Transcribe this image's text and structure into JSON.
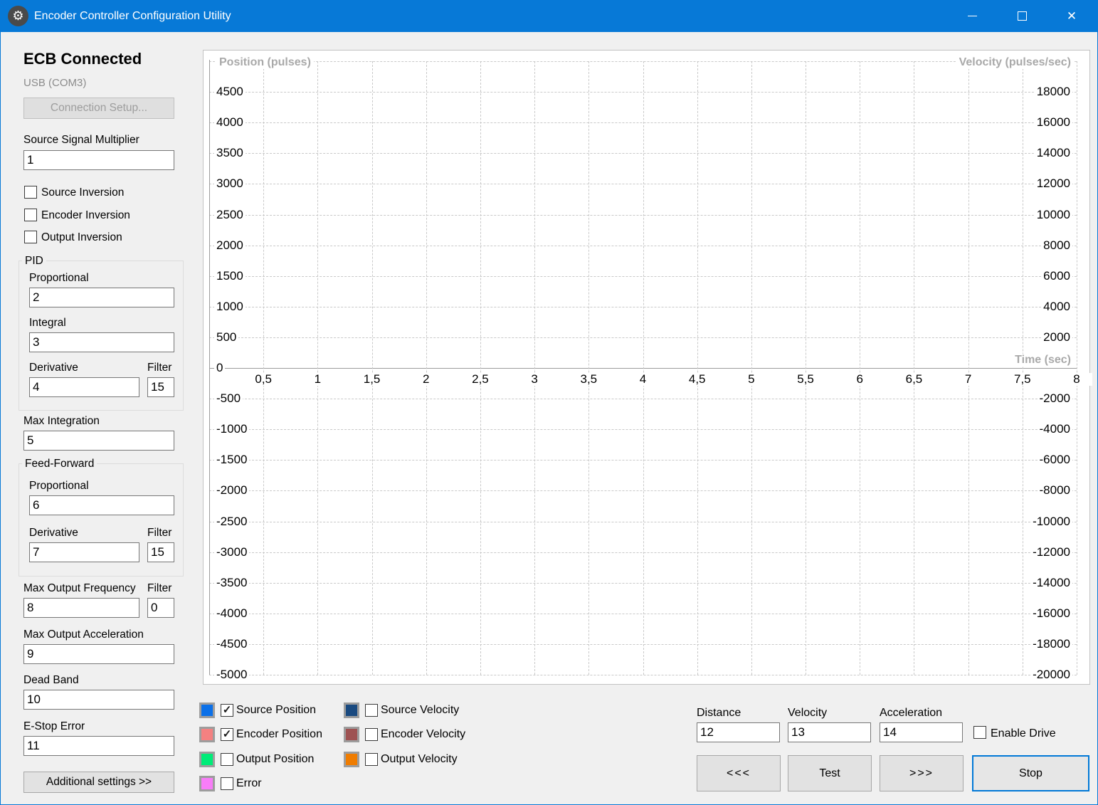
{
  "window": {
    "title": "Encoder Controller Configuration Utility",
    "app_icon_glyph": "⚙",
    "close_glyph": "✕"
  },
  "sidebar": {
    "status_heading": "ECB Connected",
    "port_label": "USB (COM3)",
    "connection_setup_button": "Connection Setup...",
    "source_signal_multiplier": {
      "label": "Source Signal Multiplier",
      "value": "1"
    },
    "source_inversion_label": "Source Inversion",
    "encoder_inversion_label": "Encoder Inversion",
    "output_inversion_label": "Output Inversion",
    "pid": {
      "title": "PID",
      "proportional_label": "Proportional",
      "proportional_value": "2",
      "integral_label": "Integral",
      "integral_value": "3",
      "derivative_label": "Derivative",
      "derivative_value": "4",
      "filter_label": "Filter",
      "filter_value": "15"
    },
    "max_integration": {
      "label": "Max Integration",
      "value": "5"
    },
    "feed_forward": {
      "title": "Feed-Forward",
      "proportional_label": "Proportional",
      "proportional_value": "6",
      "derivative_label": "Derivative",
      "derivative_value": "7",
      "filter_label": "Filter",
      "filter_value": "15"
    },
    "max_output_frequency": {
      "label": "Max Output Frequency",
      "value": "8",
      "filter_label": "Filter",
      "filter_value": "0"
    },
    "max_output_acceleration": {
      "label": "Max Output Acceleration",
      "value": "9"
    },
    "dead_band": {
      "label": "Dead Band",
      "value": "10"
    },
    "e_stop_error": {
      "label": "E-Stop Error",
      "value": "11"
    },
    "additional_settings_button": "Additional settings >>"
  },
  "chart_data": {
    "type": "line",
    "title": "",
    "grid": "dashed",
    "x_axis": {
      "label": "Time (sec)",
      "min": 0,
      "max": 8,
      "tick_step": 0.5,
      "tick_labels": [
        "0,5",
        "1",
        "1,5",
        "2",
        "2,5",
        "3",
        "3,5",
        "4",
        "4,5",
        "5",
        "5,5",
        "6",
        "6,5",
        "7",
        "7,5",
        "8"
      ]
    },
    "y_axis_left": {
      "label": "Position (pulses)",
      "min": -5000,
      "max": 5000,
      "grid_step": 500,
      "tick_labels": [
        "4500",
        "4000",
        "3500",
        "3000",
        "2500",
        "2000",
        "1500",
        "1000",
        "500",
        "0",
        "-500",
        "-1000",
        "-1500",
        "-2000",
        "-2500",
        "-3000",
        "-3500",
        "-4000",
        "-4500",
        "-5000"
      ]
    },
    "y_axis_right": {
      "label": "Velocity (pulses/sec)",
      "min": -20000,
      "max": 20000,
      "grid_step": 2000,
      "tick_labels": [
        "18000",
        "16000",
        "14000",
        "12000",
        "10000",
        "8000",
        "6000",
        "4000",
        "2000",
        "",
        "-2000",
        "-4000",
        "-6000",
        "-8000",
        "-10000",
        "-12000",
        "-14000",
        "-16000",
        "-18000",
        "-20000"
      ]
    },
    "series": [
      {
        "name": "Source Position",
        "color": "#0b70e8",
        "visible": true,
        "points": []
      },
      {
        "name": "Encoder Position",
        "color": "#f48181",
        "visible": true,
        "points": []
      },
      {
        "name": "Output Position",
        "color": "#00ec78",
        "visible": false,
        "points": []
      },
      {
        "name": "Error",
        "color": "#f87df8",
        "visible": false,
        "points": []
      },
      {
        "name": "Source Velocity",
        "color": "#1a4a80",
        "visible": false,
        "points": []
      },
      {
        "name": "Encoder Velocity",
        "color": "#9e5252",
        "visible": false,
        "points": []
      },
      {
        "name": "Output Velocity",
        "color": "#ef7c00",
        "visible": false,
        "points": []
      }
    ]
  },
  "legend": {
    "items": [
      {
        "label": "Source Position",
        "color": "#0b70e8",
        "checked": true
      },
      {
        "label": "Encoder Position",
        "color": "#f48181",
        "checked": true
      },
      {
        "label": "Output Position",
        "color": "#00ec78",
        "checked": false
      },
      {
        "label": "Error",
        "color": "#f87df8",
        "checked": false
      },
      {
        "label": "Source Velocity",
        "color": "#1a4a80",
        "checked": false
      },
      {
        "label": "Encoder Velocity",
        "color": "#9e5252",
        "checked": false
      },
      {
        "label": "Output Velocity",
        "color": "#ef7c00",
        "checked": false
      }
    ]
  },
  "drive_controls": {
    "distance": {
      "label": "Distance",
      "value": "12"
    },
    "velocity": {
      "label": "Velocity",
      "value": "13"
    },
    "acceleration": {
      "label": "Acceleration",
      "value": "14"
    },
    "enable_drive_label": "Enable Drive",
    "buttons": {
      "reverse": "<<<",
      "test": "Test",
      "forward": ">>>",
      "stop": "Stop"
    }
  }
}
